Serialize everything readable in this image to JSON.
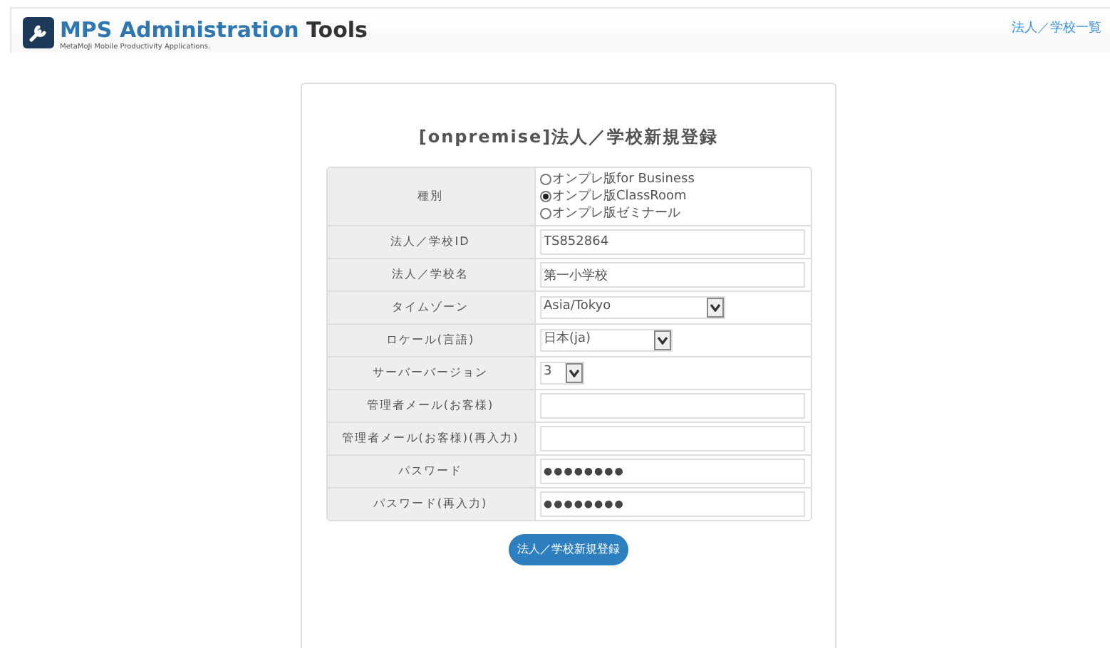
{
  "header": {
    "title_main": "MPS Administration",
    "title_accent": "Tools",
    "subtitle": "MetaMoJi Mobile Productivity Applications.",
    "link": "法人／学校一覧"
  },
  "form": {
    "title": "[onpremise]法人／学校新規登録",
    "rows": [
      {
        "label": "種別",
        "kind": "radio",
        "options": [
          {
            "label": "オンプレ版for Business",
            "selected": false
          },
          {
            "label": "オンプレ版ClassRoom",
            "selected": true
          },
          {
            "label": "オンプレ版ゼミナール",
            "selected": false
          }
        ]
      },
      {
        "label": "法人／学校ID",
        "kind": "text",
        "value": "TS852864"
      },
      {
        "label": "法人／学校名",
        "kind": "text",
        "value": "第一小学校"
      },
      {
        "label": "タイムゾーン",
        "kind": "select",
        "value": "Asia/Tokyo"
      },
      {
        "label": "ロケール(言語)",
        "kind": "select",
        "value": "日本(ja)"
      },
      {
        "label": "サーバーバージョン",
        "kind": "select",
        "value": "3"
      },
      {
        "label": "管理者メール(お客様)",
        "kind": "text"
      },
      {
        "label": "管理者メール(お客様)(再入力)",
        "kind": "text"
      },
      {
        "label": "パスワード",
        "kind": "password",
        "value": "●●●●●●●●"
      },
      {
        "label": "パスワード(再入力)",
        "kind": "password",
        "value": "●●●●●●●●"
      }
    ],
    "submit": "法人／学校新規登録"
  }
}
